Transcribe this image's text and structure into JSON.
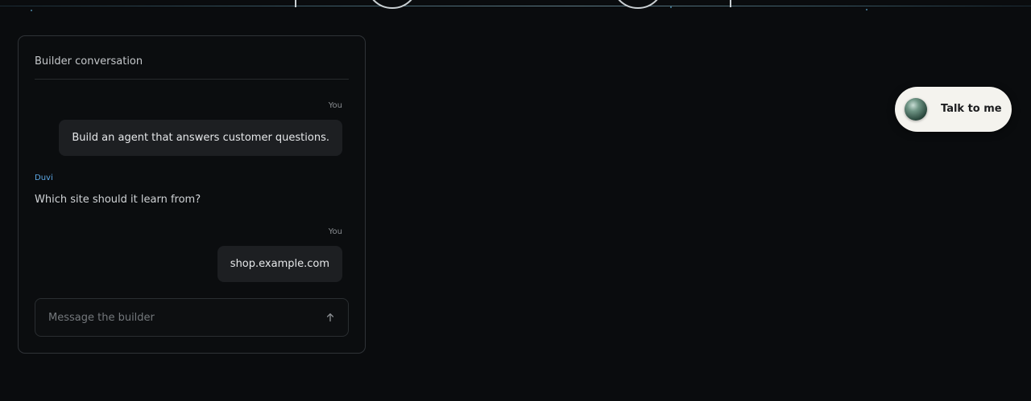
{
  "panel": {
    "title": "Builder conversation",
    "messages": [
      {
        "sender": "You",
        "text": "Build an agent that answers customer questions."
      },
      {
        "sender": "Duvi",
        "text": "Which site should it learn from?"
      },
      {
        "sender": "You",
        "text": "shop.example.com"
      }
    ],
    "composer": {
      "placeholder": "Message the builder",
      "value": "",
      "send_icon": "arrow-up-icon"
    }
  },
  "talk_button": {
    "label": "Talk to me",
    "orb_icon": "voice-orb-icon"
  },
  "colors": {
    "background": "#0a0c0e",
    "bubble": "#1d1f22",
    "assistant_name": "#5da8e6",
    "pill": "#f4f3ee"
  }
}
